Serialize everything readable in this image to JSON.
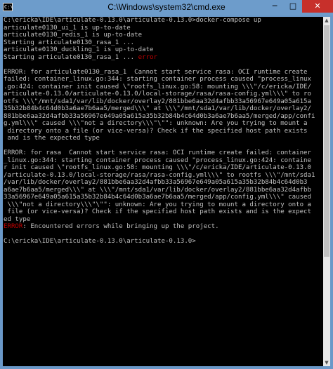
{
  "window": {
    "title": "C:\\Windows\\system32\\cmd.exe",
    "icon_text": "C:\\",
    "minimize": "─",
    "maximize": "□",
    "close": "✕"
  },
  "console": {
    "lines": [
      {
        "text": "C:\\ericka\\IDE\\articulate-0.13.0\\articulate-0.13.0>docker-compose up"
      },
      {
        "text": "articulate0130_ui_1 is up-to-date"
      },
      {
        "text": "articulate0130_redis_1 is up-to-date"
      },
      {
        "text": "Starting articulate0130_rasa_1 ..."
      },
      {
        "text": "articulate0130_duckling_1 is up-to-date"
      },
      {
        "text": "Starting articulate0130_rasa_1 ... ",
        "red": "error"
      },
      {
        "text": ""
      },
      {
        "text": "ERROR: for articulate0130_rasa_1  Cannot start service rasa: OCI runtime create"
      },
      {
        "text": "failed: container_linux.go:344: starting container process caused \"process_linux"
      },
      {
        "text": ".go:424: container init caused \\\"rootfs_linux.go:58: mounting \\\\\\\"/c/ericka/IDE/"
      },
      {
        "text": "articulate-0.13.0/articulate-0.13.0/local-storage/rasa/rasa-config.yml\\\\\\\" to ro"
      },
      {
        "text": "otfs \\\\\\\"/mnt/sda1/var/lib/docker/overlay2/881bbe6aa32d4afbb33a56967e649a05a615a"
      },
      {
        "text": "35b32b84b4c64d0b3a6ae7b6aa5/merged\\\\\\\" at \\\\\\\"/mnt/sda1/var/lib/docker/overlay2/"
      },
      {
        "text": "881bbe6aa32d4afbb33a56967e649a05a615a35b32b84b4c64d0b3a6ae7b6aa5/merged/app/confi"
      },
      {
        "text": "g.yml\\\\\\\" caused \\\\\\\"not a directory\\\\\\\"\\\"\": unknown: Are you trying to mount a"
      },
      {
        "text": " directory onto a file (or vice-versa)? Check if the specified host path exists"
      },
      {
        "text": " and is the expected type"
      },
      {
        "text": ""
      },
      {
        "text": "ERROR: for rasa  Cannot start service rasa: OCI runtime create failed: container"
      },
      {
        "text": "_linux.go:344: starting container process caused \"process_linux.go:424: containe"
      },
      {
        "text": "r init caused \\\"rootfs_linux.go:58: mounting \\\\\\\"/c/ericka/IDE/articulate-0.13.0"
      },
      {
        "text": "/articulate-0.13.0/local-storage/rasa/rasa-config.yml\\\\\\\" to rootfs \\\\\\\"/mnt/sda1"
      },
      {
        "text": "/var/lib/docker/overlay2/881bbe6aa32d4afbb33a56967e649a05a615a35b32b84b4c64d0b3"
      },
      {
        "text": "a6ae7b6aa5/merged\\\\\\\" at \\\\\\\"/mnt/sda1/var/lib/docker/overlay2/881bbe6aa32d4afbb"
      },
      {
        "text": "33a56967e649a05a615a35b32b84b4c64d0b3a6ae7b6aa5/merged/app/config.yml\\\\\\\" caused"
      },
      {
        "text": " \\\\\\\"not a directory\\\\\\\"\\\"\": unknown: Are you trying to mount a directory onto a"
      },
      {
        "text": " file (or vice-versa)? Check if the specified host path exists and is the expect"
      },
      {
        "text": "ed type"
      },
      {
        "text": ": Encountered errors while bringing up the project.",
        "red_prefix": "ERROR"
      },
      {
        "text": ""
      },
      {
        "text": "C:\\ericka\\IDE\\articulate-0.13.0\\articulate-0.13.0>"
      }
    ]
  },
  "colors": {
    "console_bg": "#000000",
    "console_text": "#c0c0c0",
    "error_text": "#c00000",
    "titlebar": "#6d9ccb",
    "close_button": "#c7302b"
  }
}
